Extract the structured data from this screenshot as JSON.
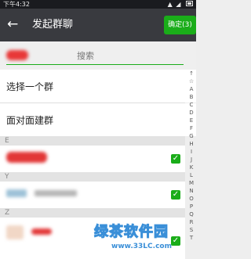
{
  "status_bar": {
    "time": "下午4:32",
    "icons": "▲ ◢",
    "battery": "battery-icon"
  },
  "toolbar": {
    "back_icon": "←",
    "title": "发起群聊",
    "confirm_label": "确定(3)"
  },
  "search": {
    "placeholder": "搜索"
  },
  "menu": {
    "select_group": "选择一个群",
    "face_to_face": "面对面建群"
  },
  "sections": [
    "E",
    "Y",
    "Z"
  ],
  "index_letters": [
    "↑",
    "☆",
    "A",
    "B",
    "C",
    "D",
    "E",
    "F",
    "G",
    "H",
    "I",
    "J",
    "K",
    "L",
    "M",
    "N",
    "O",
    "P",
    "Q",
    "R",
    "S",
    "T"
  ],
  "check_mark": "✓",
  "watermark": {
    "main": "绿茶软件园",
    "sub": "www.33LC.com"
  },
  "colors": {
    "toolbar": "#393a3f",
    "accent": "#1aad19",
    "watermark": "#3a8fd8"
  }
}
